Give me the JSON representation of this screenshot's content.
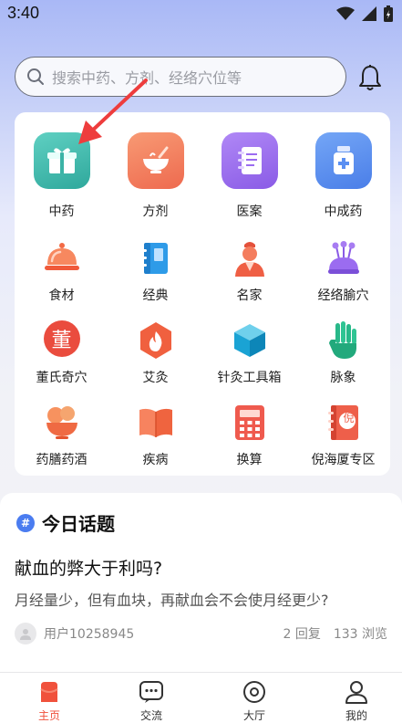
{
  "status": {
    "time": "3:40"
  },
  "search": {
    "placeholder": "搜索中药、方剂、经络穴位等"
  },
  "grid": {
    "row1": [
      {
        "label": "中药",
        "icon": "gift-box-icon",
        "color": "#4dc0b2"
      },
      {
        "label": "方剂",
        "icon": "mortar-bowl-icon",
        "color": "#f07a5c"
      },
      {
        "label": "医案",
        "icon": "notebook-icon",
        "color": "#9b6cf0"
      },
      {
        "label": "中成药",
        "icon": "medicine-bottle-icon",
        "color": "#5a8ff2"
      }
    ],
    "row2": [
      {
        "label": "食材",
        "icon": "food-cover-icon"
      },
      {
        "label": "经典",
        "icon": "book-icon"
      },
      {
        "label": "名家",
        "icon": "doctor-icon"
      },
      {
        "label": "经络腧穴",
        "icon": "acupoint-icon"
      }
    ],
    "row3": [
      {
        "label": "董氏奇穴",
        "icon": "dong-seal-icon",
        "glyph": "董"
      },
      {
        "label": "艾灸",
        "icon": "moxibustion-flame-icon"
      },
      {
        "label": "针灸工具箱",
        "icon": "toolbox-icon"
      },
      {
        "label": "脉象",
        "icon": "hand-icon"
      }
    ],
    "row4": [
      {
        "label": "药膳药酒",
        "icon": "food-bowl-icon"
      },
      {
        "label": "疾病",
        "icon": "open-book-icon"
      },
      {
        "label": "换算",
        "icon": "calculator-icon"
      },
      {
        "label": "倪海厦专区",
        "icon": "ni-book-icon",
        "glyph": "倪"
      }
    ]
  },
  "topic": {
    "badge": "#",
    "heading": "今日话题",
    "post_title": "献血的弊大于利吗?",
    "post_body": "月经量少，但有血块，再献血会不会使月经更少?",
    "user": "用户10258945",
    "replies": "2 回复",
    "views": "133 浏览"
  },
  "tabs": [
    {
      "label": "主页",
      "icon": "home-icon",
      "active": true
    },
    {
      "label": "交流",
      "icon": "chat-icon"
    },
    {
      "label": "大厅",
      "icon": "hall-icon"
    },
    {
      "label": "我的",
      "icon": "profile-icon"
    }
  ],
  "colors": {
    "accent": "#f0513c",
    "topic_badge": "#4a7cf0"
  }
}
